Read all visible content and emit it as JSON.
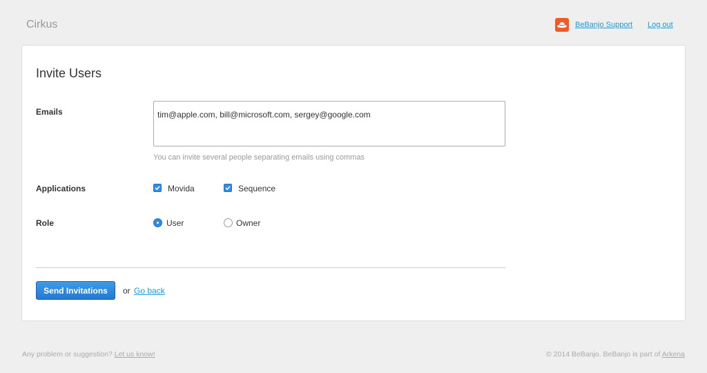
{
  "header": {
    "brand": "Cirkus",
    "support_link": "BeBanjo Support",
    "logout_link": "Log out",
    "support_logo_icon": "bebanjo-hat-icon",
    "support_logo_color": "#f05a28"
  },
  "form": {
    "title": "Invite Users",
    "emails": {
      "label": "Emails",
      "value": "tim@apple.com, bill@microsoft.com, sergey@google.com",
      "hint": "You can invite several people separating emails using commas"
    },
    "applications": {
      "label": "Applications",
      "options": [
        {
          "label": "Movida",
          "checked": true
        },
        {
          "label": "Sequence",
          "checked": true
        }
      ]
    },
    "role": {
      "label": "Role",
      "options": [
        {
          "label": "User",
          "selected": true
        },
        {
          "label": "Owner",
          "selected": false
        }
      ]
    },
    "submit_label": "Send Invitations",
    "or_text": "or",
    "back_link": "Go back"
  },
  "footer": {
    "left_text": "Any problem or suggestion?",
    "left_link": "Let us know!",
    "right_text": "© 2014 BeBanjo. BeBanjo is part of",
    "right_link": "Arkena"
  },
  "colors": {
    "accent": "#2f8be6",
    "link": "#1a9ad6",
    "background": "#efefef"
  }
}
